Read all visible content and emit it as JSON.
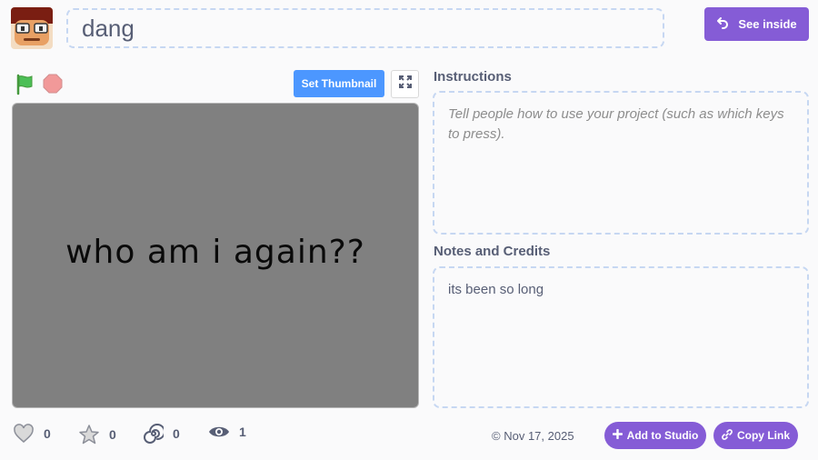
{
  "project": {
    "title": "dang"
  },
  "toolbar": {
    "see_inside_label": "See inside",
    "set_thumbnail_label": "Set Thumbnail"
  },
  "stage": {
    "text": "who am i again??"
  },
  "instructions": {
    "heading": "Instructions",
    "placeholder": "Tell people how to use your project (such as which keys to press)."
  },
  "notes": {
    "heading": "Notes and Credits",
    "text": "its been so long"
  },
  "stats": {
    "loves": "0",
    "favorites": "0",
    "remixes": "0",
    "views": "1"
  },
  "footer": {
    "date": "Nov 17, 2025",
    "add_to_studio_label": "Add to Studio",
    "copy_link_label": "Copy Link"
  },
  "icons": {
    "green_flag": "green-flag-icon",
    "stop": "stop-icon",
    "fullscreen": "fullscreen-icon",
    "see_inside": "remix-arrows-icon",
    "love": "heart-icon",
    "favorite": "star-icon",
    "remix": "spiral-icon",
    "views": "eye-icon",
    "copyright": "copyright-icon",
    "add": "plus-icon",
    "link": "link-icon"
  },
  "colors": {
    "accent_purple": "#855cd6",
    "accent_blue": "#4c97ff",
    "stage_bg": "#808080",
    "flag_green": "#4cbf56",
    "stop_red": "#ec5959"
  }
}
